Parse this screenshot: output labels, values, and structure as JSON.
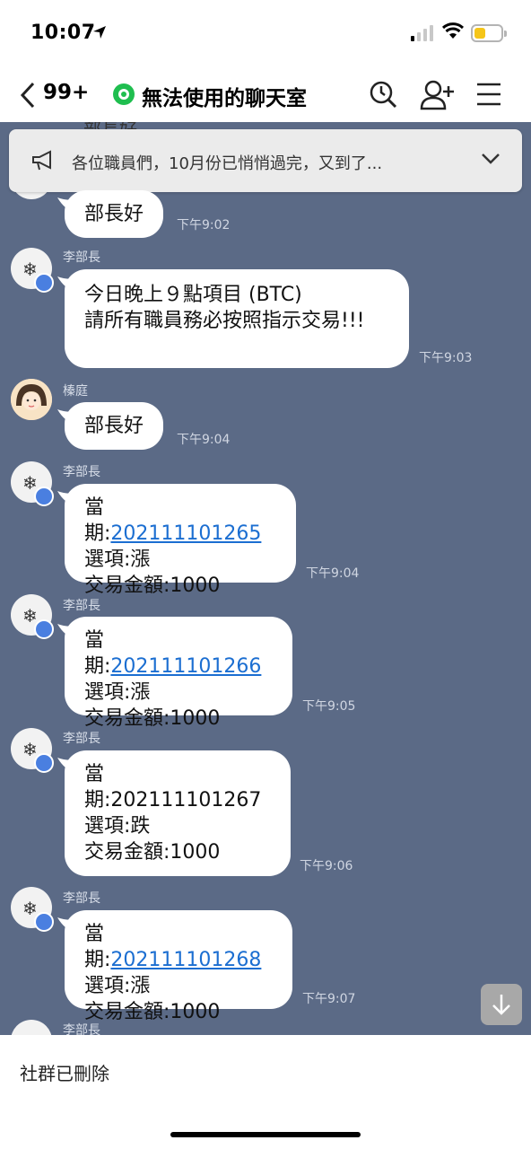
{
  "status": {
    "time": "10:07",
    "icons": [
      "location-arrow-icon",
      "cellular-signal-icon",
      "wifi-icon",
      "battery-icon"
    ],
    "battery_color": "#f5c518"
  },
  "header": {
    "back_count": "99+",
    "title": "無法使用的聊天室",
    "icons": [
      "chevron-left-icon",
      "open-chat-icon",
      "search-icon",
      "add-friend-icon",
      "menu-icon"
    ]
  },
  "announcement": {
    "text": "各位職員們，10月份已悄悄過完，又到了...",
    "icons": [
      "megaphone-icon",
      "chevron-down-icon"
    ]
  },
  "peek_top_text": "部長好",
  "messages": [
    {
      "sender": "",
      "text": "部長好",
      "time": "下午9:02"
    },
    {
      "sender": "李部長",
      "lines": [
        "今日晚上９點項目 (BTC)",
        "請所有職員務必按照指示交易!!!"
      ],
      "time": "下午9:03"
    },
    {
      "sender": "榛庭",
      "text": "部長好",
      "time": "下午9:04"
    },
    {
      "sender": "李部長",
      "period_label": "當期:",
      "period": "202111101265",
      "option": "選項:漲",
      "amount": "交易金額:1000",
      "time": "下午9:04"
    },
    {
      "sender": "李部長",
      "period_label": "當期:",
      "period": "202111101266",
      "option": "選項:漲",
      "amount": "交易金額:1000",
      "time": "下午9:05"
    },
    {
      "sender": "李部長",
      "period_label": "當期:",
      "period": "202111101267",
      "option": "選項:跌",
      "amount": "交易金額:1000",
      "time": "下午9:06"
    },
    {
      "sender": "李部長",
      "period_label": "當期:",
      "period": "202111101268",
      "option": "選項:漲",
      "amount": "交易金額:1000",
      "time": "下午9:07"
    }
  ],
  "peek_bottom_name": "李部長",
  "footer": {
    "text": "社群已刪除"
  },
  "colors": {
    "chat_background": "#5b6a86",
    "link": "#1b6ed1",
    "open_chat_green": "#1fbe4f",
    "crown_badge": "#4a7fe0"
  }
}
